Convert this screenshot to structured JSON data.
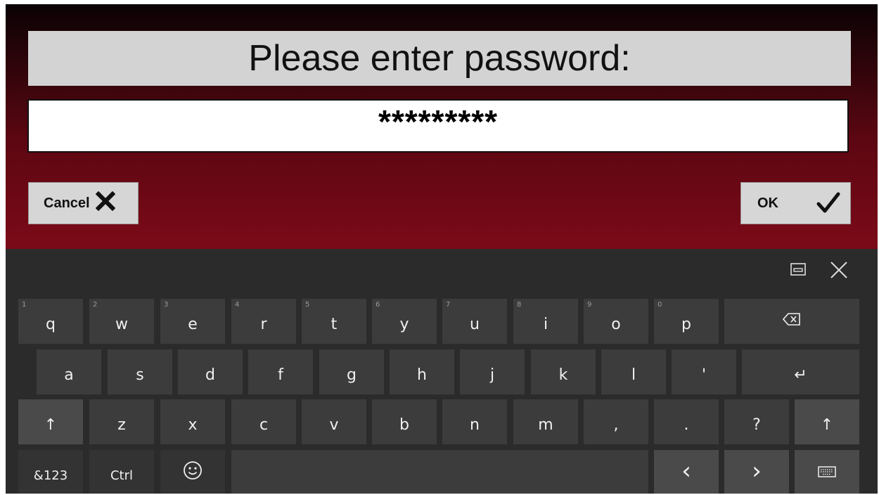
{
  "dialog": {
    "prompt": "Please enter password:",
    "password_masked": "*********",
    "cancel_label": "Cancel",
    "ok_label": "OK",
    "colors": {
      "gradient_top": "#0a0204",
      "gradient_bottom": "#7c0a18",
      "panel": "#d3d3d3"
    }
  },
  "keyboard": {
    "top_icons": [
      "keyboard-layout-icon",
      "close-icon"
    ],
    "row1": {
      "hints": [
        "1",
        "2",
        "3",
        "4",
        "5",
        "6",
        "7",
        "8",
        "9",
        "0"
      ],
      "keys": [
        "q",
        "w",
        "e",
        "r",
        "t",
        "y",
        "u",
        "i",
        "o",
        "p"
      ],
      "backspace_icon": "backspace-icon"
    },
    "row2": {
      "keys": [
        "a",
        "s",
        "d",
        "f",
        "g",
        "h",
        "j",
        "k",
        "l",
        "'"
      ],
      "enter_glyph": "↵"
    },
    "row3": {
      "shift_glyph": "↑",
      "keys": [
        "z",
        "x",
        "c",
        "v",
        "b",
        "n",
        "m",
        ",",
        ".",
        "?"
      ]
    },
    "row4": {
      "symbols_label": "&123",
      "ctrl_label": "Ctrl",
      "emoji_icon": "smiley-icon",
      "left_glyph": "‹",
      "right_glyph": "›",
      "keyboard_icon": "keyboard-icon"
    },
    "colors": {
      "background": "#2b2b2b",
      "key": "#3c3c3c",
      "key_special": "#4a4a4a",
      "text": "#f0f0f0"
    }
  }
}
